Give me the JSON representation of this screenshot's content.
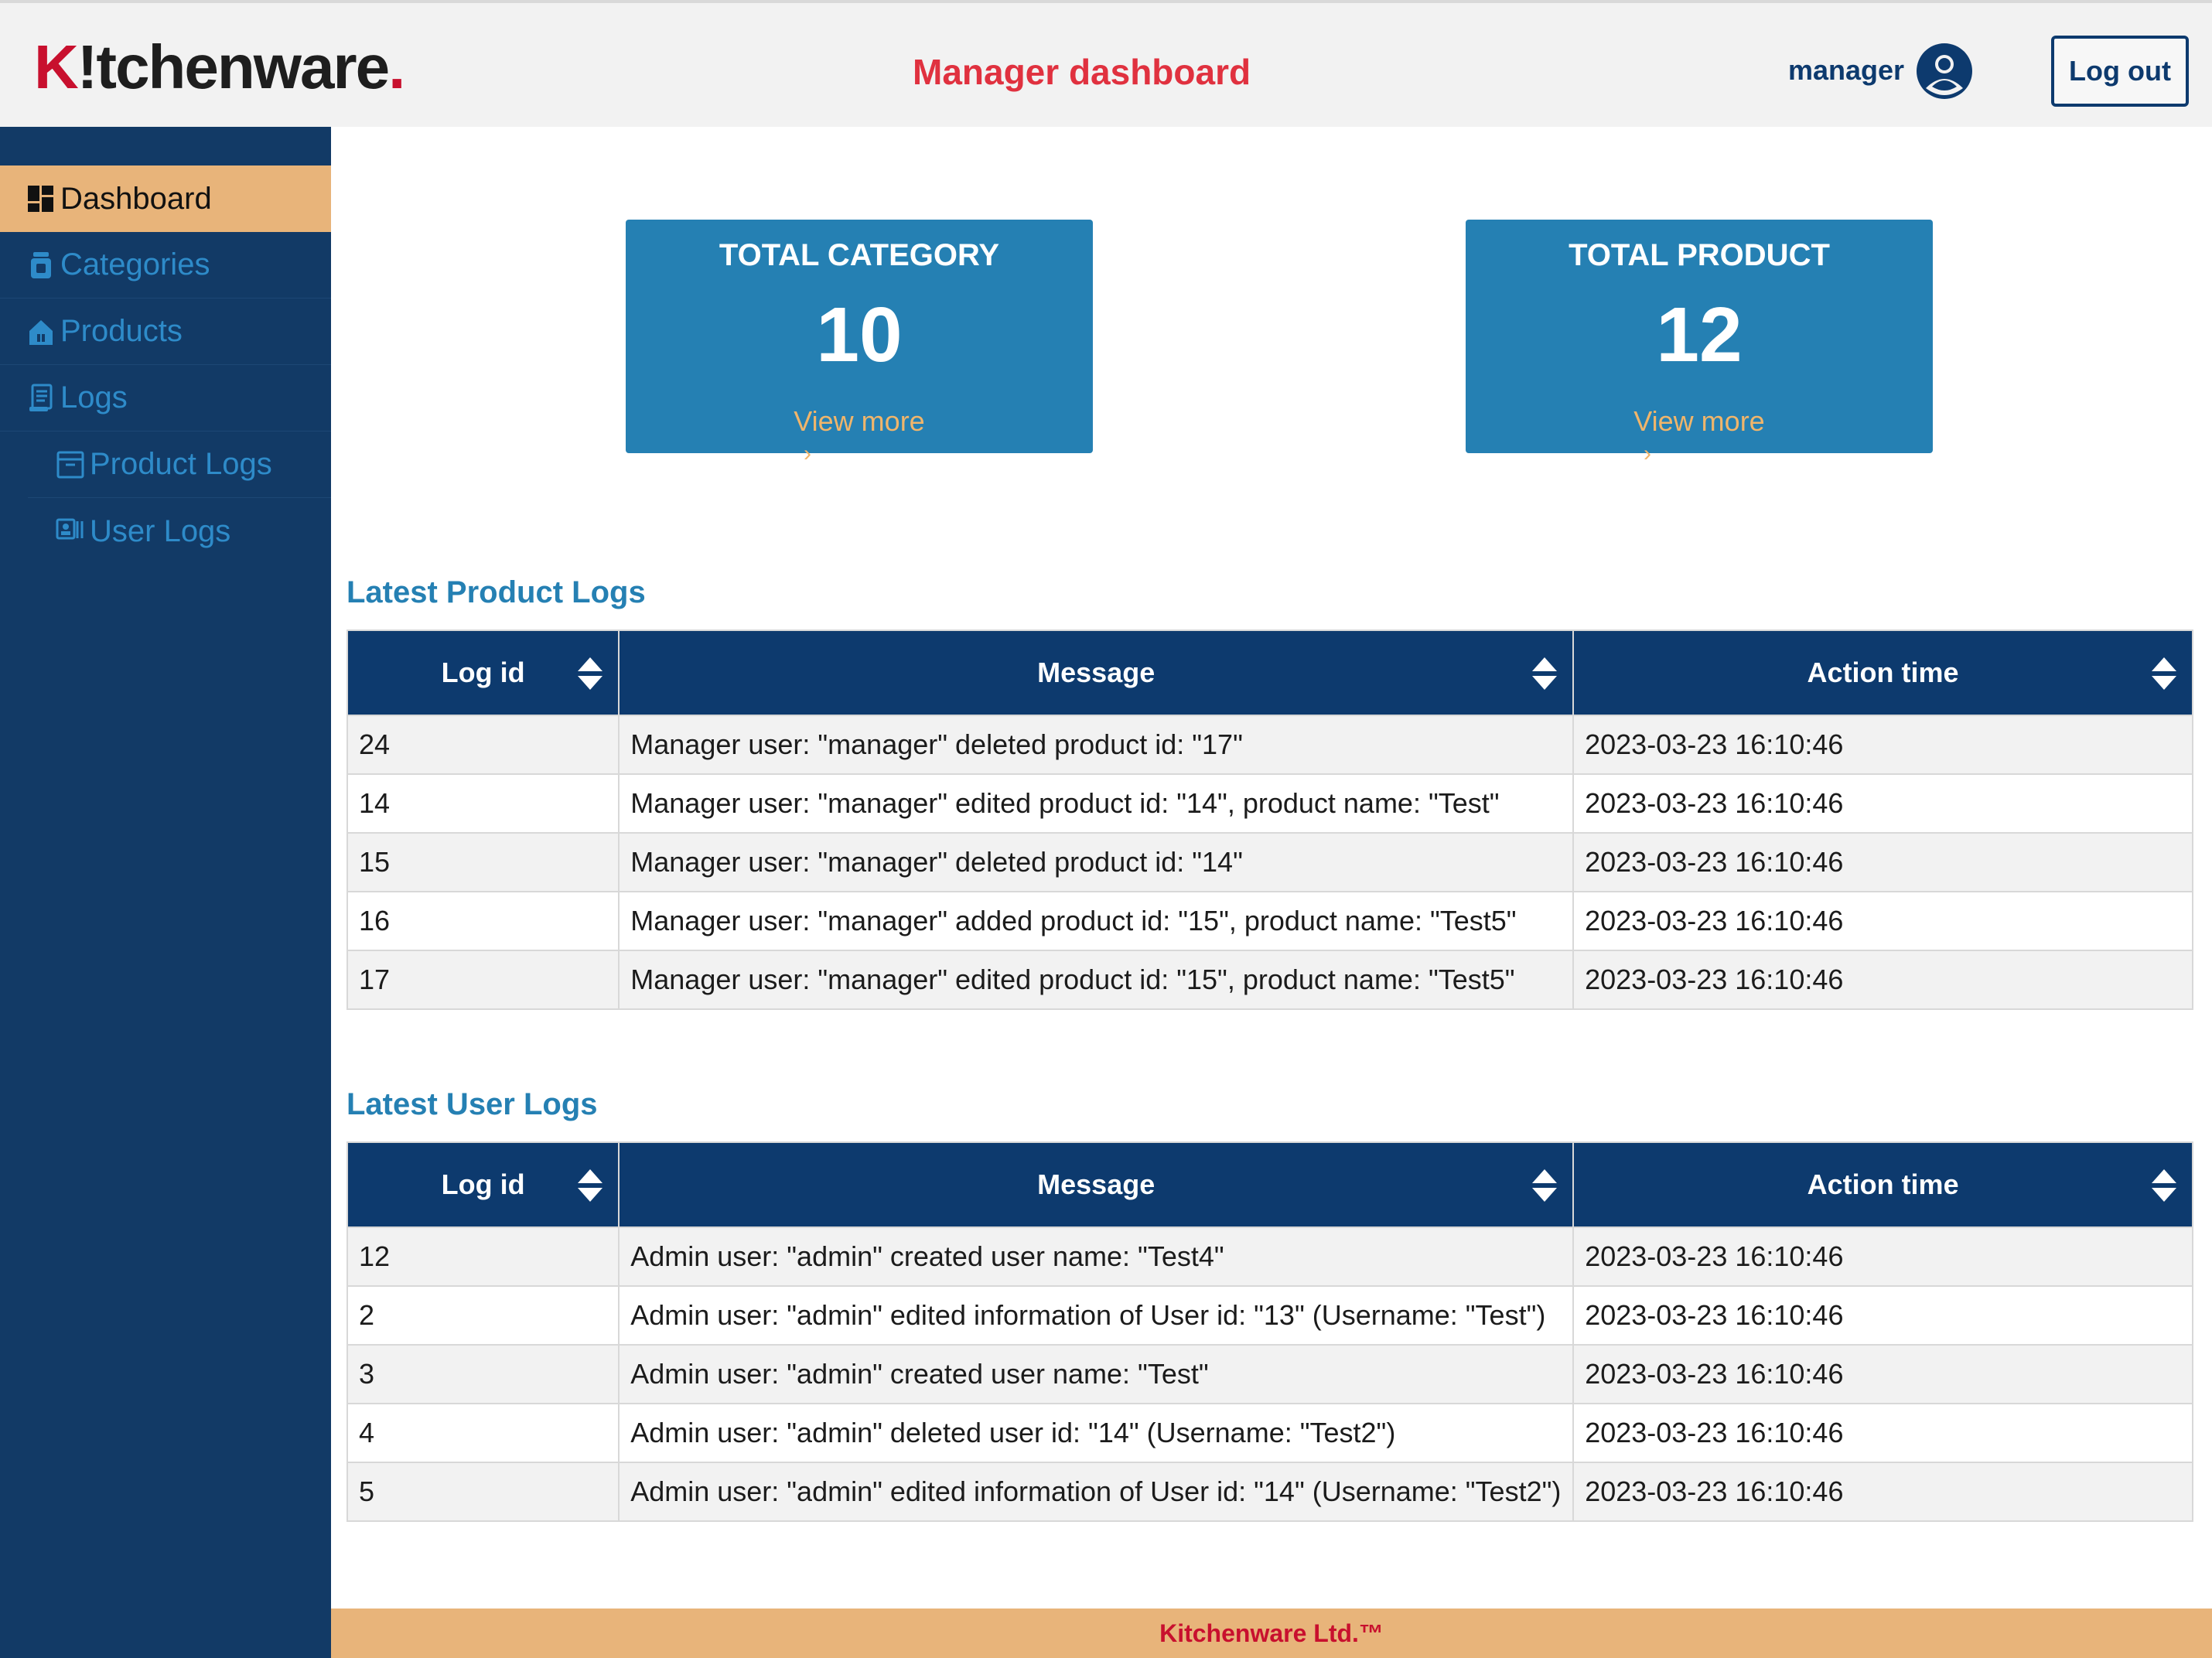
{
  "header": {
    "logo": {
      "k": "K",
      "rest": "!tchenware",
      "dot": "."
    },
    "title": "Manager dashboard",
    "username": "manager",
    "logout_label": "Log out"
  },
  "sidebar": {
    "items": [
      {
        "label": "Dashboard",
        "icon": "dashboard-grid-icon",
        "active": true
      },
      {
        "label": "Categories",
        "icon": "jar-icon"
      },
      {
        "label": "Products",
        "icon": "house-icon"
      },
      {
        "label": "Logs",
        "icon": "document-icon"
      },
      {
        "label": "Product Logs",
        "icon": "archive-box-icon",
        "sub": true
      },
      {
        "label": "User Logs",
        "icon": "id-card-icon",
        "sub": true
      }
    ]
  },
  "cards": [
    {
      "title": "TOTAL CATEGORY",
      "value": "10",
      "link": "View more",
      "chevron": "›"
    },
    {
      "title": "TOTAL PRODUCT",
      "value": "12",
      "link": "View more",
      "chevron": "›"
    }
  ],
  "product_logs": {
    "title": "Latest Product Logs",
    "columns": [
      "Log id",
      "Message",
      "Action time"
    ],
    "rows": [
      [
        "24",
        "Manager user: \"manager\" deleted product id: \"17\"",
        "2023-03-23 16:10:46"
      ],
      [
        "14",
        "Manager user: \"manager\" edited product id: \"14\", product name: \"Test\"",
        "2023-03-23 16:10:46"
      ],
      [
        "15",
        "Manager user: \"manager\" deleted product id: \"14\"",
        "2023-03-23 16:10:46"
      ],
      [
        "16",
        "Manager user: \"manager\" added product id: \"15\", product name: \"Test5\"",
        "2023-03-23 16:10:46"
      ],
      [
        "17",
        "Manager user: \"manager\" edited product id: \"15\", product name: \"Test5\"",
        "2023-03-23 16:10:46"
      ]
    ]
  },
  "user_logs": {
    "title": "Latest User Logs",
    "columns": [
      "Log id",
      "Message",
      "Action time"
    ],
    "rows": [
      [
        "12",
        "Admin user: \"admin\" created user name: \"Test4\"",
        "2023-03-23 16:10:46"
      ],
      [
        "2",
        "Admin user: \"admin\" edited information of User id: \"13\" (Username: \"Test\")",
        "2023-03-23 16:10:46"
      ],
      [
        "3",
        "Admin user: \"admin\" created user name: \"Test\"",
        "2023-03-23 16:10:46"
      ],
      [
        "4",
        "Admin user: \"admin\" deleted user id: \"14\" (Username: \"Test2\")",
        "2023-03-23 16:10:46"
      ],
      [
        "5",
        "Admin user: \"admin\" edited information of User id: \"14\" (Username: \"Test2\")",
        "2023-03-23 16:10:46"
      ]
    ]
  },
  "footer": {
    "text": "Kitchenware Ltd.™"
  },
  "colors": {
    "navy": "#0d3a6e",
    "sidebar": "#123a66",
    "accent_orange": "#e8b47a",
    "card_blue": "#2580b3",
    "brand_red": "#c8102e"
  }
}
